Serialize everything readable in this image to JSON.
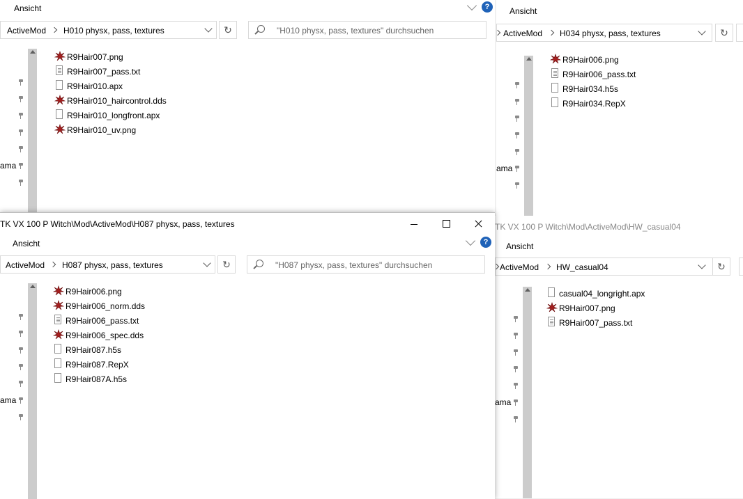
{
  "windows": {
    "top_left": {
      "ribbon_label": "Ansicht",
      "breadcrumb": [
        "ActiveMod",
        "H010 physx, pass, textures"
      ],
      "search_placeholder": "\"H010 physx, pass, textures\" durchsuchen",
      "nav_label": "ama",
      "files": [
        {
          "name": "R9Hair007.png",
          "icon": "image-file-icon"
        },
        {
          "name": "R9Hair007_pass.txt",
          "icon": "text-file-icon"
        },
        {
          "name": "R9Hair010.apx",
          "icon": "generic-file-icon"
        },
        {
          "name": "R9Hair010_haircontrol.dds",
          "icon": "image-file-icon"
        },
        {
          "name": "R9Hair010_longfront.apx",
          "icon": "generic-file-icon"
        },
        {
          "name": "R9Hair010_uv.png",
          "icon": "image-file-icon"
        }
      ]
    },
    "top_right": {
      "ribbon_label": "Ansicht",
      "breadcrumb": [
        "ActiveMod",
        "H034 physx, pass, textures"
      ],
      "nav_label": "ama",
      "files": [
        {
          "name": "R9Hair006.png",
          "icon": "image-file-icon"
        },
        {
          "name": "R9Hair006_pass.txt",
          "icon": "text-file-icon"
        },
        {
          "name": "R9Hair034.h5s",
          "icon": "generic-file-icon"
        },
        {
          "name": "R9Hair034.RepX",
          "icon": "generic-file-icon"
        }
      ]
    },
    "bottom_left": {
      "title": "TK VX 100 P Witch\\Mod\\ActiveMod\\H087 physx, pass, textures",
      "ribbon_label": "Ansicht",
      "breadcrumb": [
        "ActiveMod",
        "H087 physx, pass, textures"
      ],
      "search_placeholder": "\"H087 physx, pass, textures\" durchsuchen",
      "nav_label": "ama",
      "files": [
        {
          "name": "R9Hair006.png",
          "icon": "image-file-icon"
        },
        {
          "name": "R9Hair006_norm.dds",
          "icon": "image-file-icon"
        },
        {
          "name": "R9Hair006_pass.txt",
          "icon": "text-file-icon"
        },
        {
          "name": "R9Hair006_spec.dds",
          "icon": "image-file-icon"
        },
        {
          "name": "R9Hair087.h5s",
          "icon": "generic-file-icon"
        },
        {
          "name": "R9Hair087.RepX",
          "icon": "generic-file-icon"
        },
        {
          "name": "R9Hair087A.h5s",
          "icon": "generic-file-icon"
        }
      ]
    },
    "bottom_right": {
      "title": "TK VX 100 P Witch\\Mod\\ActiveMod\\HW_casual04",
      "ribbon_label": "Ansicht",
      "breadcrumb": [
        "ActiveMod",
        "HW_casual04"
      ],
      "nav_label": "ama",
      "files": [
        {
          "name": "casual04_longright.apx",
          "icon": "generic-file-icon"
        },
        {
          "name": "R9Hair007.png",
          "icon": "image-file-icon"
        },
        {
          "name": "R9Hair007_pass.txt",
          "icon": "text-file-icon"
        }
      ]
    }
  },
  "colors": {
    "help_badge": "#1f62b8",
    "image_icon": "#a41e1e",
    "window_bg": "#ffffff",
    "border": "#d9d9d9"
  }
}
